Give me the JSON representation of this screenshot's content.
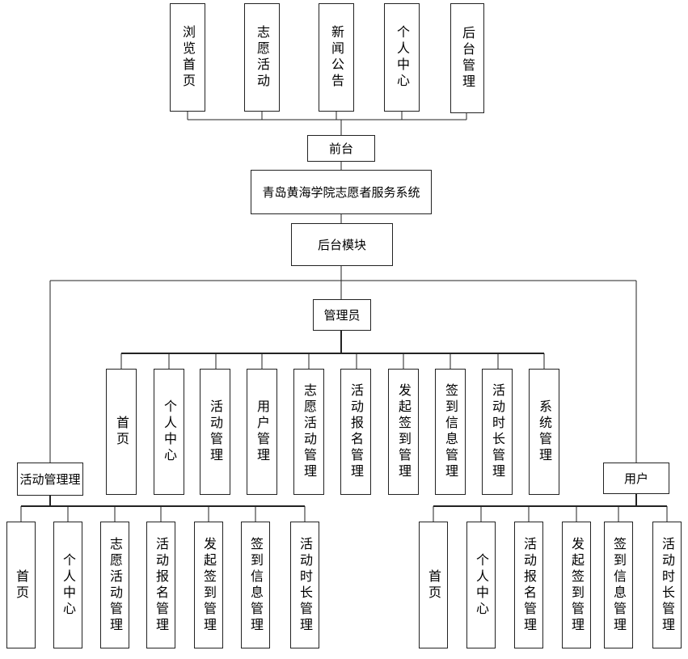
{
  "diagram": {
    "system_title": "青岛黄海学院志愿者服务系统",
    "frontend": {
      "label": "前台",
      "items": [
        "浏览首页",
        "志愿活动",
        "新闻公告",
        "个人中心",
        "后台管理"
      ]
    },
    "backend_module": {
      "label": "后台模块"
    },
    "admin": {
      "label": "管理员",
      "items": [
        "首页",
        "个人中心",
        "活动管理",
        "用户管理",
        "志愿活动管理",
        "活动报名管理",
        "发起签到管理",
        "签到信息管理",
        "活动时长管理",
        "系统管理"
      ]
    },
    "activity_manager": {
      "label": "活动管理理",
      "items": [
        "首页",
        "个人中心",
        "志愿活动管理",
        "活动报名管理",
        "发起签到管理",
        "签到信息管理",
        "活动时长管理"
      ]
    },
    "user": {
      "label": "用户",
      "items": [
        "首页",
        "个人中心",
        "活动报名管理",
        "发起签到管理",
        "签到信息管理",
        "活动时长管理"
      ]
    }
  }
}
